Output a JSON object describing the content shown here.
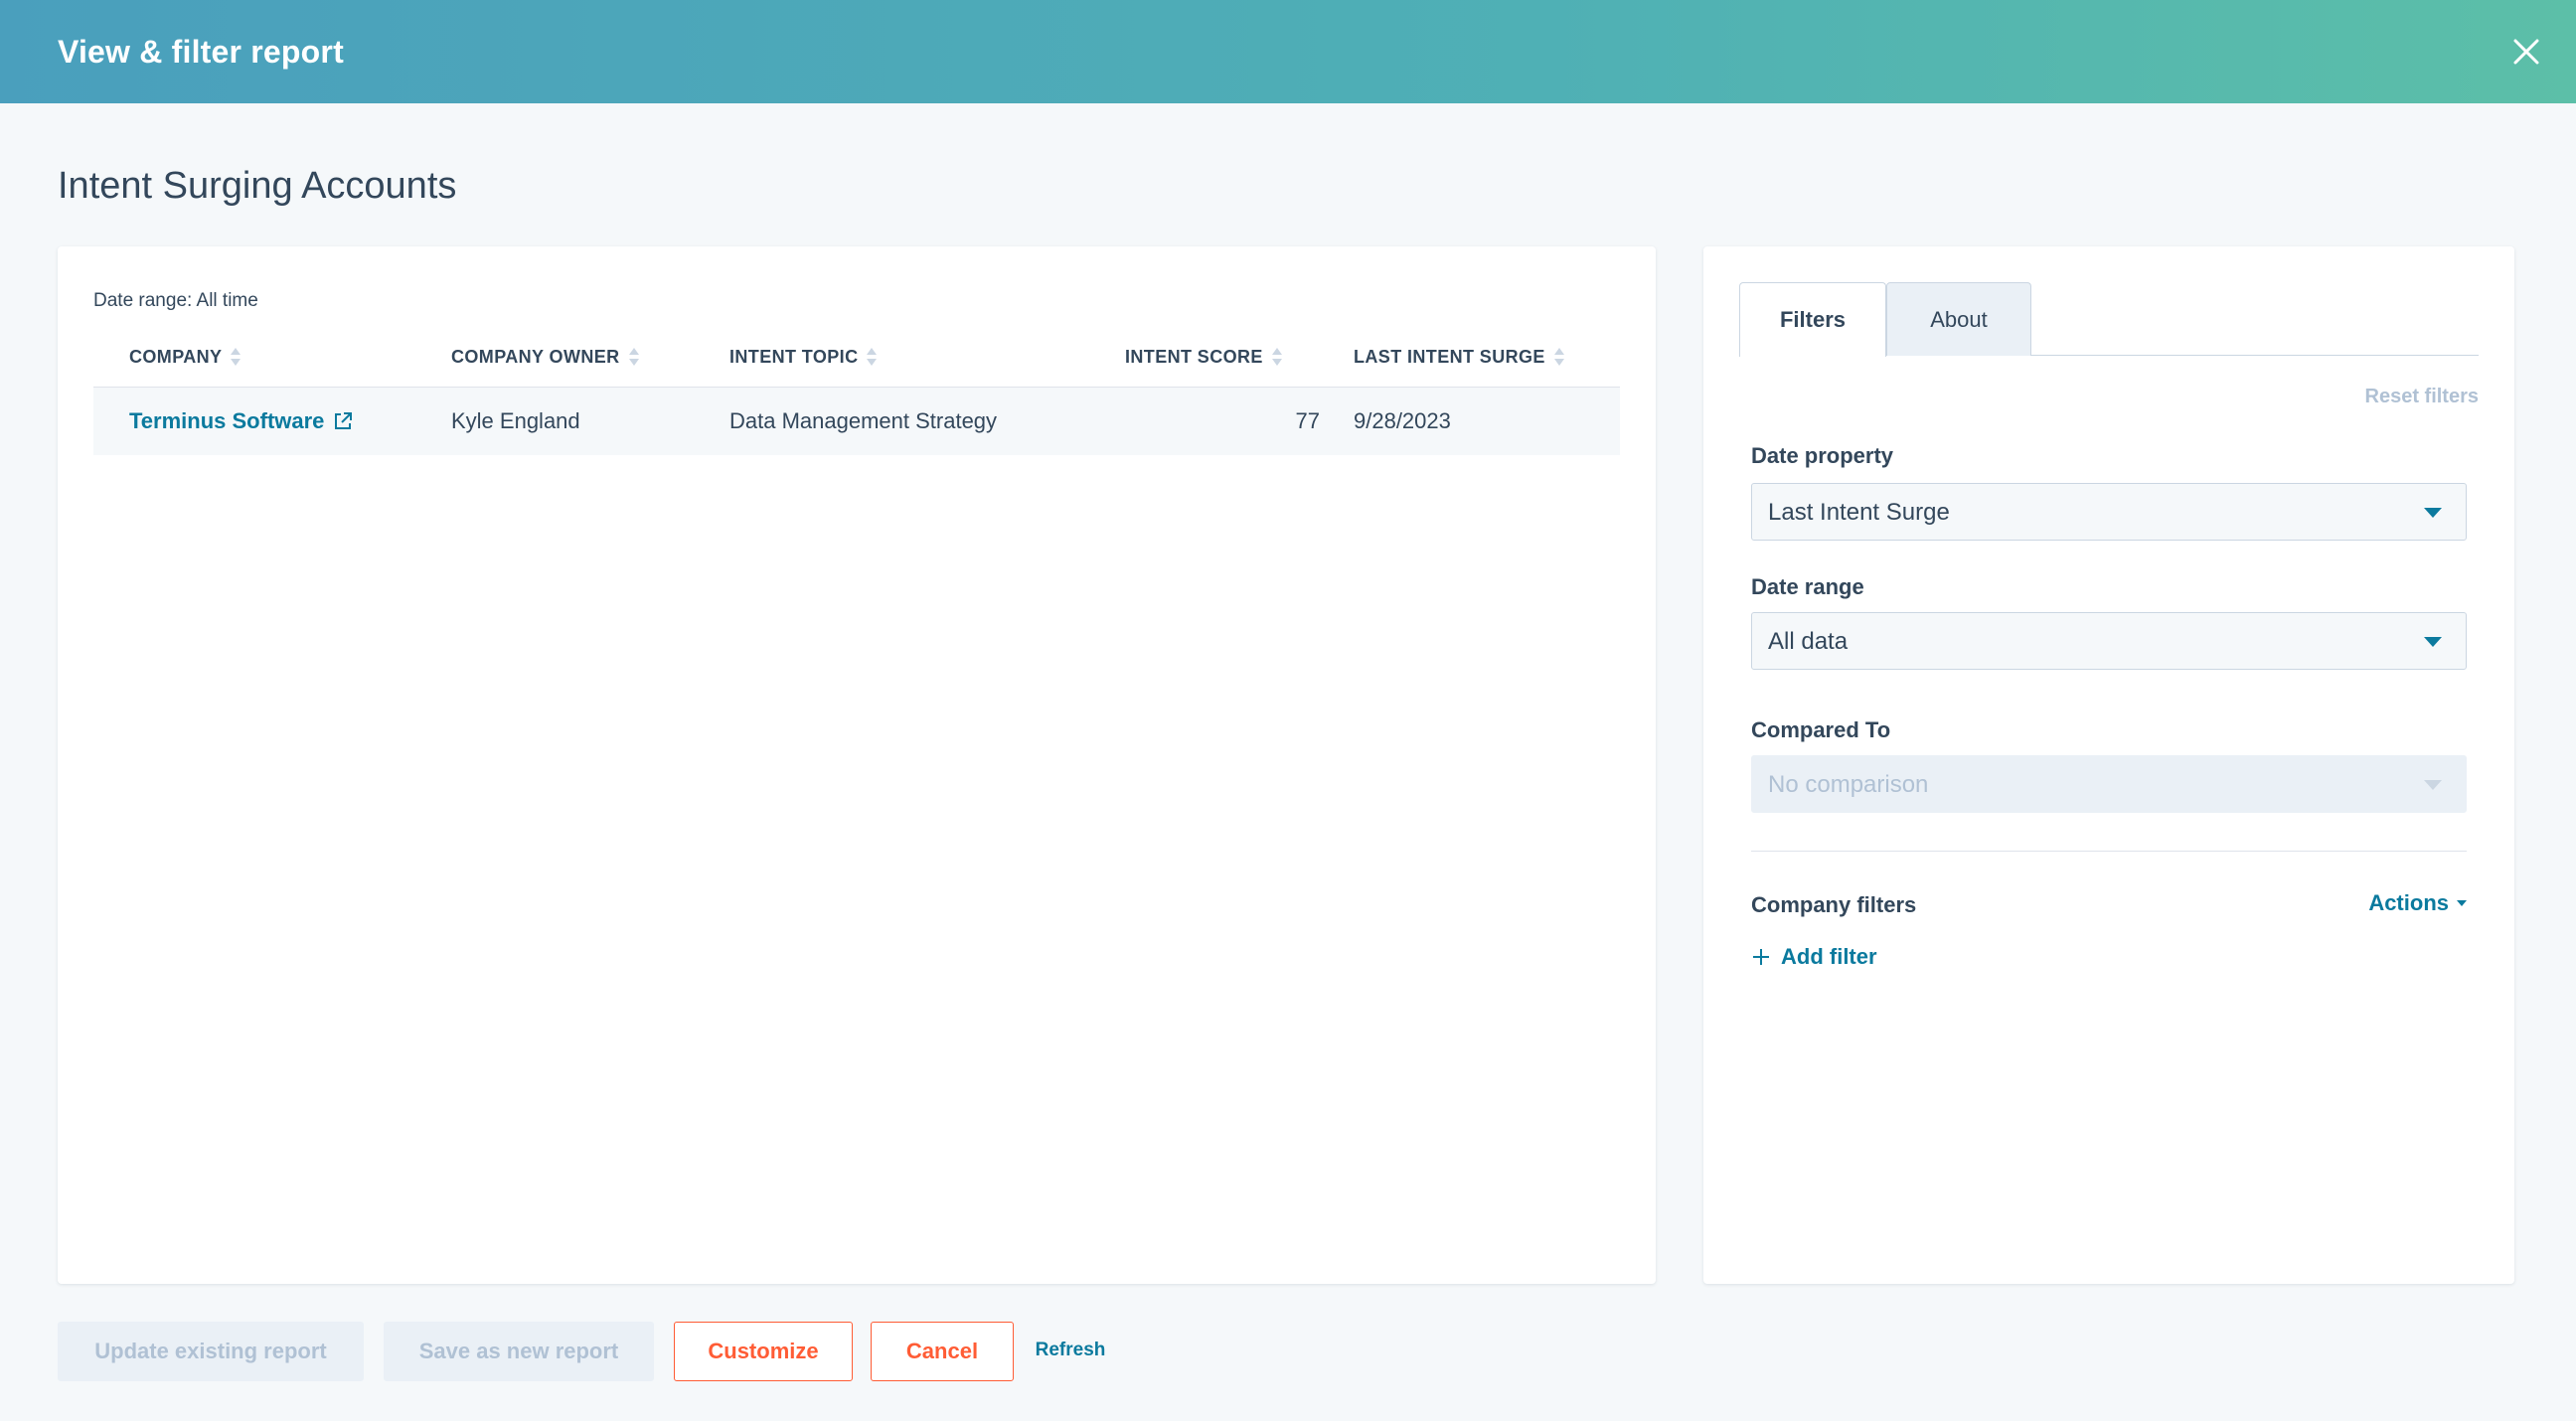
{
  "header": {
    "title": "View & filter report"
  },
  "page": {
    "title": "Intent Surging Accounts"
  },
  "report": {
    "date_range_label": "Date range: All time",
    "columns": [
      "COMPANY",
      "COMPANY OWNER",
      "INTENT TOPIC",
      "INTENT SCORE",
      "LAST INTENT SURGE"
    ],
    "rows": [
      {
        "company": "Terminus Software",
        "owner": "Kyle England",
        "topic": "Data Management Strategy",
        "score": "77",
        "last_surge": "9/28/2023"
      }
    ]
  },
  "filters": {
    "tabs": [
      {
        "label": "Filters",
        "active": true
      },
      {
        "label": "About",
        "active": false
      }
    ],
    "reset_label": "Reset filters",
    "date_property": {
      "label": "Date property",
      "value": "Last Intent Surge"
    },
    "date_range": {
      "label": "Date range",
      "value": "All data"
    },
    "compared_to": {
      "label": "Compared To",
      "value": "No comparison"
    },
    "company_filters": {
      "label": "Company filters",
      "actions_label": "Actions",
      "add_filter_label": "Add filter"
    }
  },
  "footer": {
    "update_label": "Update existing report",
    "save_new_label": "Save as new report",
    "customize_label": "Customize",
    "cancel_label": "Cancel",
    "refresh_label": "Refresh"
  },
  "colors": {
    "header_start": "#4a9fbd",
    "header_end": "#5cbfa8",
    "link": "#0b7a9e",
    "accent": "#ff5c35"
  }
}
